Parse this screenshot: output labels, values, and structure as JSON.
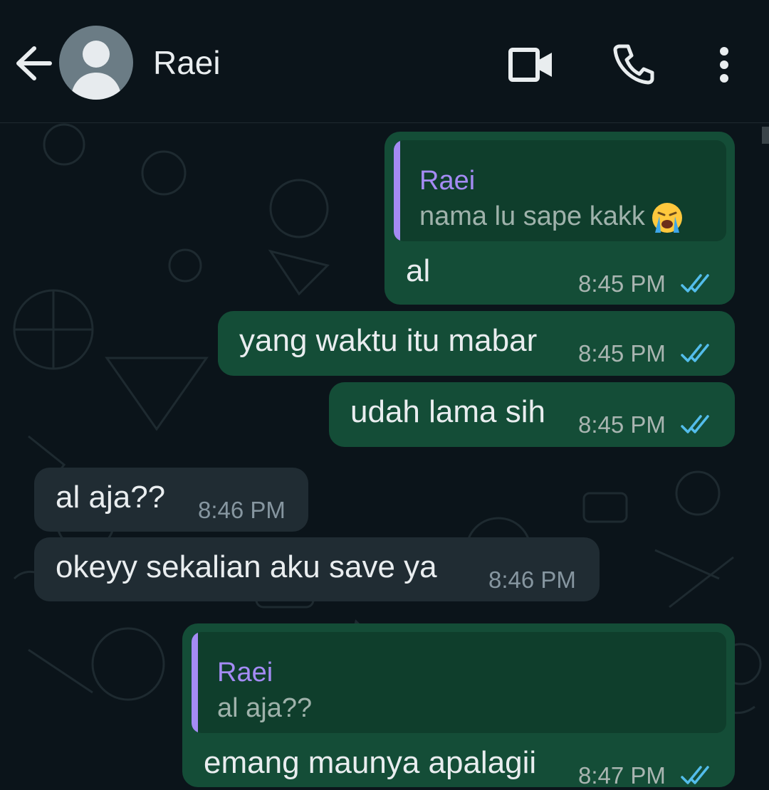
{
  "header": {
    "contact_name": "Raei",
    "back_icon": "arrow-left-icon",
    "avatar_icon": "default-avatar-icon",
    "video_call_icon": "video-camera-icon",
    "voice_call_icon": "phone-icon",
    "menu_icon": "vertical-dots-icon"
  },
  "colors": {
    "background": "#0b141a",
    "outgoing_bubble": "#144d37",
    "incoming_bubble": "#202c33",
    "reply_accent": "#a48bf4",
    "read_ticks": "#53bdeb"
  },
  "messages": [
    {
      "direction": "outgoing",
      "reply": {
        "author": "Raei",
        "text": "nama lu sape kakk",
        "emoji": "loudly-crying-face"
      },
      "text": "al",
      "time": "8:45 PM",
      "status": "read"
    },
    {
      "direction": "outgoing",
      "text": "yang waktu itu mabar",
      "time": "8:45 PM",
      "status": "read"
    },
    {
      "direction": "outgoing",
      "text": "udah lama sih",
      "time": "8:45 PM",
      "status": "read"
    },
    {
      "direction": "incoming",
      "text": "al aja??",
      "time": "8:46 PM"
    },
    {
      "direction": "incoming",
      "text": "okeyy sekalian aku save ya",
      "time": "8:46 PM"
    },
    {
      "direction": "outgoing",
      "reply": {
        "author": "Raei",
        "text": "al aja??"
      },
      "text": "emang maunya apalagii",
      "time": "8:47 PM",
      "status": "read"
    }
  ]
}
